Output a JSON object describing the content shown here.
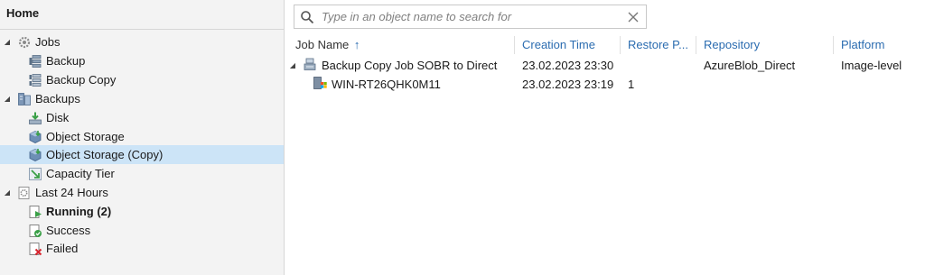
{
  "sidebar": {
    "title": "Home",
    "nodes": {
      "jobs": "Jobs",
      "backup": "Backup",
      "backup_copy": "Backup Copy",
      "backups": "Backups",
      "disk": "Disk",
      "object_storage": "Object Storage",
      "object_storage_copy": "Object Storage (Copy)",
      "capacity_tier": "Capacity Tier",
      "last24": "Last 24 Hours",
      "running": "Running (2)",
      "success": "Success",
      "failed": "Failed"
    },
    "selected": "object_storage_copy",
    "selected_color": "#cce4f7"
  },
  "search": {
    "placeholder": "Type in an object name to search for"
  },
  "table": {
    "columns": {
      "job_name": "Job Name",
      "creation_time": "Creation Time",
      "restore_points": "Restore P...",
      "repository": "Repository",
      "platform": "Platform"
    },
    "sort_indicator": "↑",
    "rows": [
      {
        "name": "Backup Copy Job SOBR to Direct",
        "creation_time": "23.02.2023 23:30",
        "restore_points": "",
        "repository": "AzureBlob_Direct",
        "platform": "Image-level"
      },
      {
        "name": "WIN-RT26QHK0M11",
        "creation_time": "23.02.2023 23:19",
        "restore_points": "1",
        "repository": "",
        "platform": ""
      }
    ]
  },
  "colors": {
    "header_link": "#2b6cb0",
    "sidebar_bg": "#f3f3f3"
  }
}
